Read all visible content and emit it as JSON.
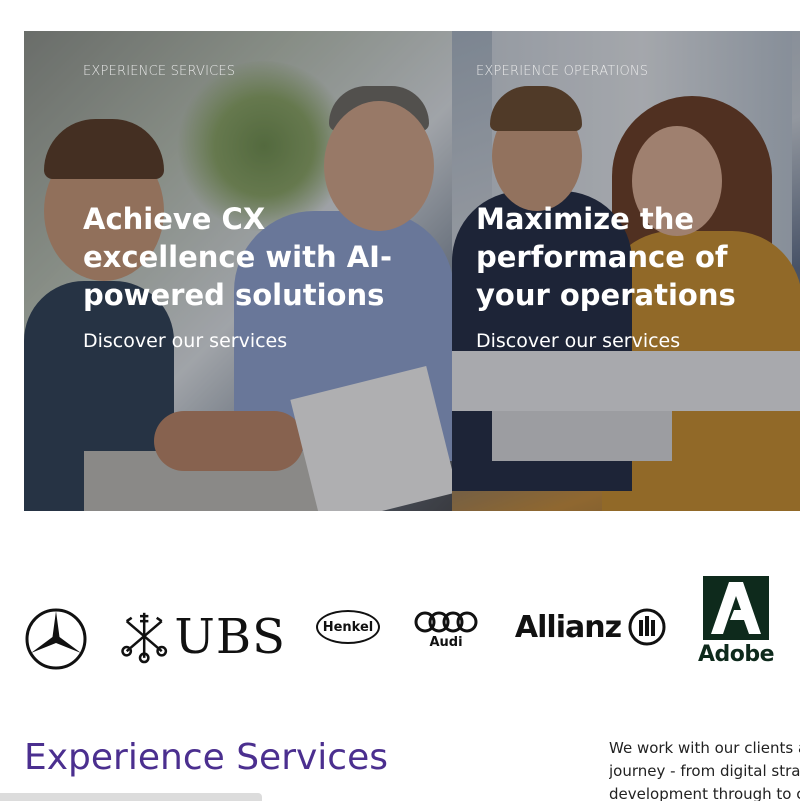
{
  "hero": {
    "left": {
      "eyebrow": "EXPERIENCE SERVICES",
      "headline_lines": [
        "Achieve CX",
        "excellence with AI-",
        "powered solutions"
      ],
      "cta": "Discover our services"
    },
    "right": {
      "eyebrow": "EXPERIENCE OPERATIONS",
      "headline_lines": [
        "Maximize the",
        "performance of",
        "your operations"
      ],
      "cta": "Discover our services"
    }
  },
  "logos": {
    "ubs": "UBS",
    "henkel": "Henkel",
    "audi": "Audi",
    "allianz": "Allianz",
    "adobe": "Adobe"
  },
  "section": {
    "title": "Experience Services",
    "text_lines": [
      "We work with our clients a",
      "journey - from digital strat",
      "development through to c"
    ]
  },
  "colors": {
    "accent": "#4b2f8f",
    "hero_text": "#ffffff"
  }
}
